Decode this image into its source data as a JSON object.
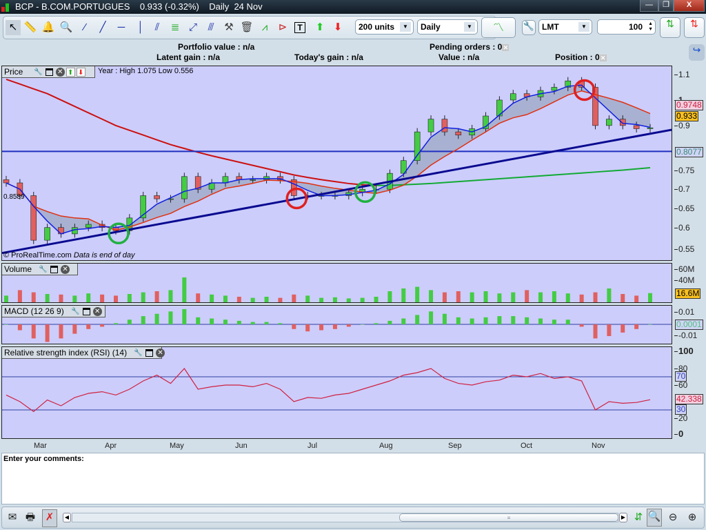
{
  "window": {
    "title": "BCP - B.COM.PORTUGUES",
    "price": "0.933 (-0.32%)",
    "period": "Daily",
    "date": "24 Nov",
    "minimize": "—",
    "restore": "❐",
    "close": "X"
  },
  "toolbar": {
    "units": "200 units",
    "timeframe": "Daily",
    "order_type": "LMT",
    "quantity": "100"
  },
  "info": {
    "portfolio_value": "Portfolio value : n/a",
    "latent_gain": "Latent gain : n/a",
    "todays_gain": "Today's gain : n/a",
    "pending_orders": "Pending orders : 0",
    "value": "Value : n/a",
    "position": "Position : 0"
  },
  "price_panel": {
    "title": "Price",
    "year_range": "Year : High 1.075 Low 0.556",
    "watermark": "© ProRealTime.com",
    "eod_note": "Data is end of day",
    "hline_label": "0.8589",
    "axis": [
      "1.1",
      "1",
      "0.9",
      "0.75",
      "0.7",
      "0.65",
      "0.6",
      "0.55"
    ],
    "tags": {
      "ma_red": "0.9748",
      "last": "0.933",
      "ma_long": "0.8077"
    }
  },
  "volume_panel": {
    "title": "Volume",
    "axis": [
      "60M",
      "40M"
    ],
    "last": "16.6M"
  },
  "macd_panel": {
    "title": "MACD (12 26 9)",
    "axis": [
      "0.01",
      "-0.01"
    ],
    "last": "0.0001"
  },
  "rsi_panel": {
    "title": "Relative strength index (RSI) (14)",
    "axis": [
      "100",
      "80",
      "60",
      "20",
      "0"
    ],
    "upper": "70",
    "lower": "30",
    "last": "42.338"
  },
  "months": [
    "Mar",
    "Apr",
    "May",
    "Jun",
    "Jul",
    "Aug",
    "Sep",
    "Oct",
    "Nov"
  ],
  "comments": {
    "label": "Enter your comments:"
  },
  "colors": {
    "panel_bg": "#cccdfb",
    "up": "#44cc44",
    "down": "#e06060",
    "ma_short": "#1020e0",
    "ma_mid": "#e03010",
    "ma_long_down": "#cc1010",
    "ma_long_up": "#11aa33",
    "trend": "#0a0a90"
  },
  "chart_data": {
    "type": "candlestick",
    "x_range": [
      "late Feb",
      "24 Nov"
    ],
    "price_ylim": [
      0.53,
      1.12
    ],
    "closes": [
      0.76,
      0.72,
      0.58,
      0.62,
      0.6,
      0.62,
      0.63,
      0.62,
      0.61,
      0.65,
      0.72,
      0.71,
      0.71,
      0.78,
      0.74,
      0.76,
      0.78,
      0.77,
      0.77,
      0.78,
      0.77,
      0.72,
      0.72,
      0.72,
      0.72,
      0.73,
      0.74,
      0.74,
      0.79,
      0.83,
      0.92,
      0.96,
      0.92,
      0.91,
      0.93,
      0.97,
      1.02,
      1.04,
      1.03,
      1.05,
      1.06,
      1.08,
      1.06,
      0.94,
      0.96,
      0.94,
      0.93,
      0.933
    ],
    "ma_long": [
      1.085,
      1.07,
      1.055,
      1.04,
      1.02,
      1.0,
      0.98,
      0.96,
      0.94,
      0.925,
      0.91,
      0.895,
      0.88,
      0.868,
      0.856,
      0.845,
      0.835,
      0.825,
      0.815,
      0.805,
      0.795,
      0.785,
      0.777,
      0.77,
      0.764,
      0.758,
      0.754,
      0.752,
      0.752,
      0.754,
      0.756,
      0.758,
      0.761,
      0.764,
      0.767,
      0.77,
      0.773,
      0.776,
      0.779,
      0.782,
      0.785,
      0.788,
      0.791,
      0.794,
      0.797,
      0.8,
      0.804,
      0.8077
    ],
    "horizontal_line": 0.8589,
    "trendline": [
      [
        0,
        0.54
      ],
      [
        47,
        0.905
      ]
    ],
    "annotations": [
      {
        "i": 8,
        "color": "green"
      },
      {
        "i": 21,
        "color": "red"
      },
      {
        "i": 26,
        "color": "green"
      },
      {
        "i": 42,
        "color": "red"
      }
    ],
    "volume_millions": [
      12,
      22,
      18,
      15,
      14,
      12,
      16,
      14,
      12,
      15,
      18,
      20,
      22,
      45,
      16,
      14,
      12,
      10,
      8,
      10,
      8,
      14,
      12,
      8,
      9,
      7,
      8,
      10,
      20,
      25,
      28,
      22,
      18,
      20,
      18,
      20,
      16,
      18,
      22,
      18,
      20,
      16,
      14,
      18,
      25,
      15,
      12,
      16.6
    ],
    "macd_hist": [
      0,
      -0.005,
      -0.012,
      -0.015,
      -0.012,
      -0.008,
      -0.004,
      -0.002,
      0.001,
      0.004,
      0.007,
      0.009,
      0.011,
      0.013,
      0.006,
      0.005,
      0.004,
      0.003,
      0.002,
      0.002,
      0.001,
      -0.004,
      -0.006,
      -0.005,
      -0.004,
      -0.002,
      0.0,
      0.001,
      0.003,
      0.005,
      0.008,
      0.011,
      0.009,
      0.006,
      0.005,
      0.006,
      0.007,
      0.007,
      0.006,
      0.005,
      0.004,
      0.004,
      -0.002,
      -0.012,
      -0.01,
      -0.007,
      -0.004,
      0.0001
    ],
    "rsi": [
      48,
      40,
      28,
      42,
      35,
      45,
      50,
      52,
      48,
      55,
      65,
      72,
      62,
      80,
      55,
      58,
      60,
      60,
      58,
      62,
      55,
      40,
      45,
      44,
      48,
      50,
      55,
      60,
      65,
      72,
      75,
      80,
      68,
      62,
      60,
      64,
      66,
      72,
      70,
      74,
      68,
      70,
      65,
      30,
      40,
      38,
      39,
      42.338
    ],
    "rsi_levels": [
      70,
      30
    ]
  }
}
